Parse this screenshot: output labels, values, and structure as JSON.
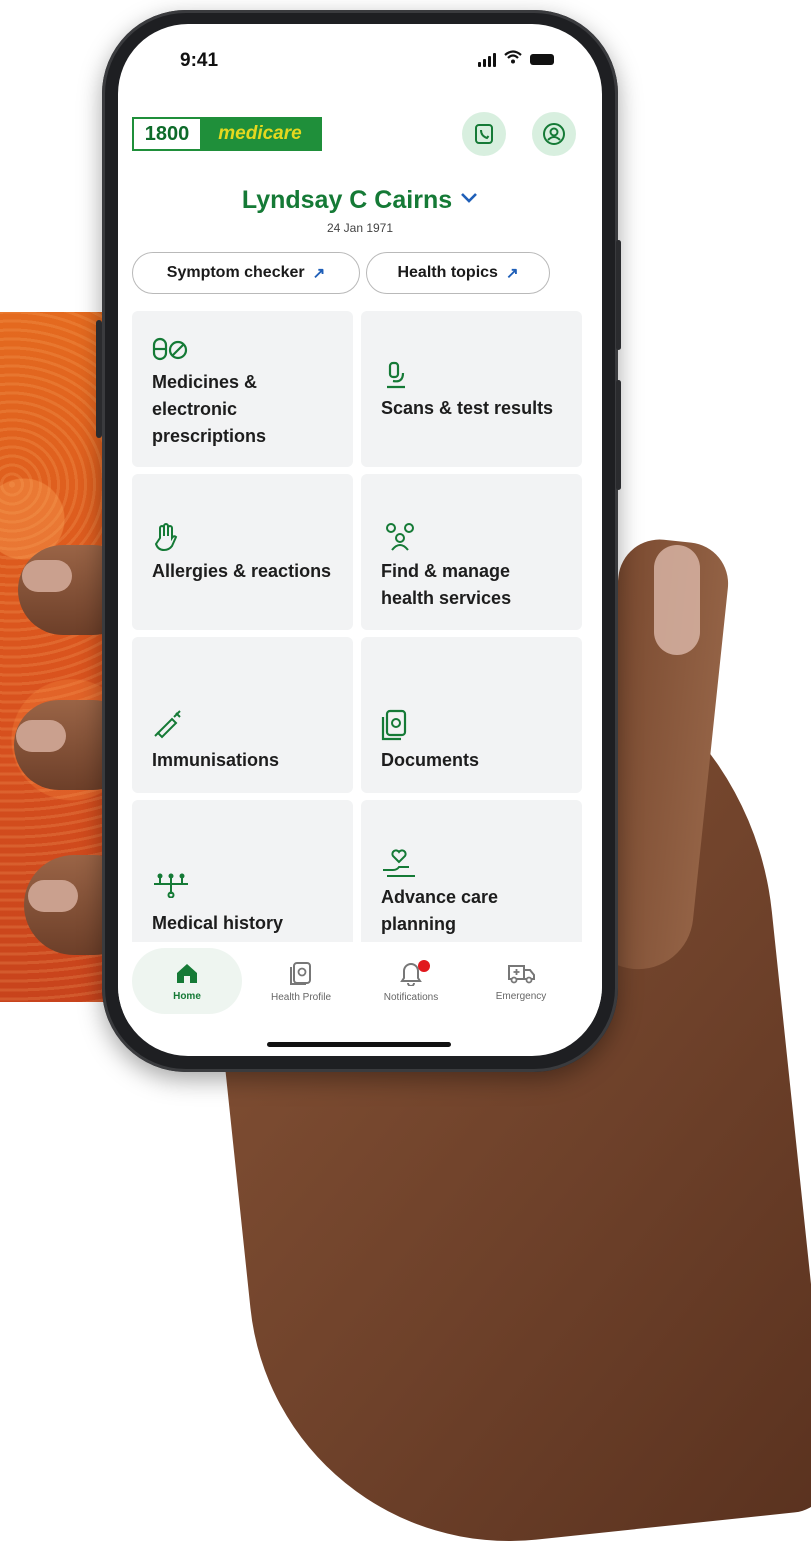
{
  "status_bar": {
    "time": "9:41"
  },
  "header": {
    "logo_number": "1800",
    "logo_word": "medicare",
    "user_name": "Lyndsay C Cairns",
    "dob": "24 Jan 1971"
  },
  "quick_links": [
    {
      "label": "Symptom checker",
      "icon": "external-arrow"
    },
    {
      "label": "Health topics",
      "icon": "external-arrow"
    }
  ],
  "tiles": [
    {
      "label": "Medicines & electronic prescriptions",
      "icon": "pills-icon"
    },
    {
      "label": "Scans & test results",
      "icon": "microscope-icon"
    },
    {
      "label": "Allergies & reactions",
      "icon": "hand-icon"
    },
    {
      "label": "Find & manage health services",
      "icon": "people-icon"
    },
    {
      "label": "Immunisations",
      "icon": "syringe-icon"
    },
    {
      "label": "Documents",
      "icon": "document-icon"
    },
    {
      "label": "Medical history",
      "icon": "family-tree-icon"
    },
    {
      "label": "Advance care planning",
      "icon": "heart-hand-icon"
    }
  ],
  "bottom_nav": [
    {
      "label": "Home",
      "icon": "home-icon",
      "active": true
    },
    {
      "label": "Health Profile",
      "icon": "health-profile-icon",
      "active": false
    },
    {
      "label": "Notifications",
      "icon": "bell-icon",
      "active": false,
      "badge": true
    },
    {
      "label": "Emergency",
      "icon": "ambulance-icon",
      "active": false
    }
  ],
  "colors": {
    "brand_green": "#157a36",
    "tile_bg": "#f2f3f4",
    "link_blue": "#1f5fb8",
    "badge_red": "#e1181d",
    "background_art": "#e46a1f"
  }
}
